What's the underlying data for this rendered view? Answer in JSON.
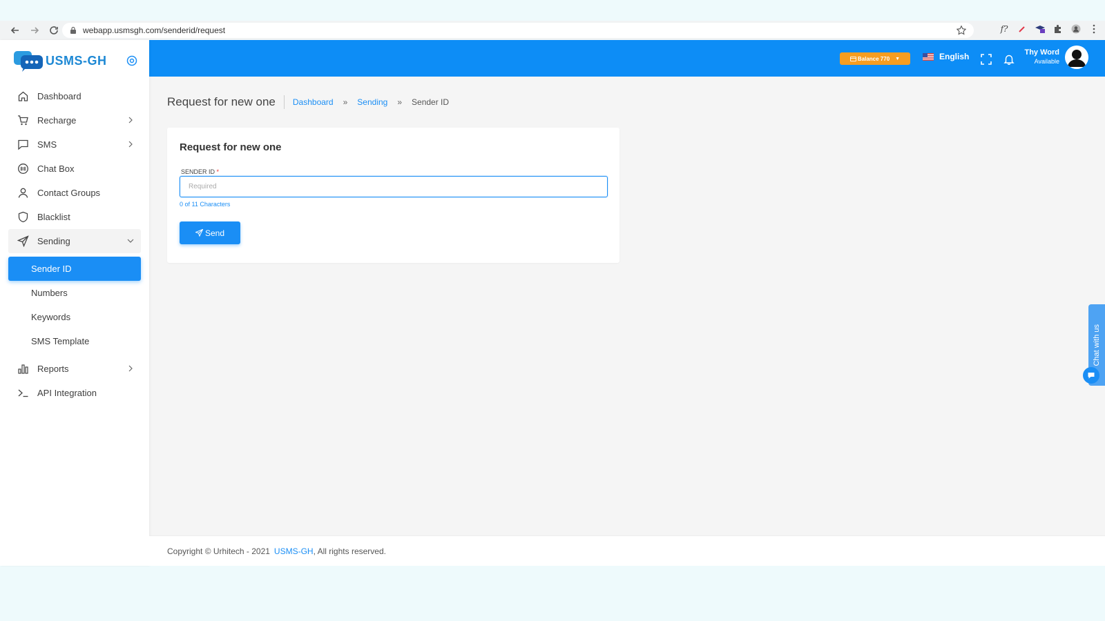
{
  "browser": {
    "url": "webapp.usmsgh.com/senderid/request",
    "ext_label": "f?"
  },
  "brand": {
    "name": "USMS-GH"
  },
  "sidebar": {
    "items": [
      {
        "label": "Dashboard",
        "icon": "home-icon"
      },
      {
        "label": "Recharge",
        "icon": "cart-icon"
      },
      {
        "label": "SMS",
        "icon": "message-icon"
      },
      {
        "label": "Chat Box",
        "icon": "chat-icon"
      },
      {
        "label": "Contact Groups",
        "icon": "user-icon"
      },
      {
        "label": "Blacklist",
        "icon": "shield-icon"
      },
      {
        "label": "Sending",
        "icon": "send-icon"
      },
      {
        "label": "Reports",
        "icon": "bar-chart-icon"
      },
      {
        "label": "API Integration",
        "icon": "terminal-icon"
      }
    ],
    "sending_sub": [
      {
        "label": "Sender ID"
      },
      {
        "label": "Numbers"
      },
      {
        "label": "Keywords"
      },
      {
        "label": "SMS Template"
      }
    ]
  },
  "topbar": {
    "balance_label": "Balance 770",
    "language": "English",
    "user_name": "Thy Word",
    "user_status": "Available"
  },
  "page": {
    "title": "Request for new one",
    "breadcrumb": [
      "Dashboard",
      "Sending",
      "Sender ID"
    ],
    "sep": "»"
  },
  "form": {
    "card_title": "Request for new one",
    "field_label": "SENDER ID",
    "required_mark": "*",
    "placeholder": "Required",
    "value": "",
    "char_count": "0 of 11 Characters",
    "send_label": "Send"
  },
  "footer": {
    "copyright": "Copyright © Urhitech - 2021",
    "brand_link": "USMS-GH",
    "rights": ", All rights reserved."
  },
  "chat_widget": {
    "label": "Chat with us"
  },
  "colors": {
    "primary": "#0d8df6",
    "balance": "#f79d20"
  }
}
